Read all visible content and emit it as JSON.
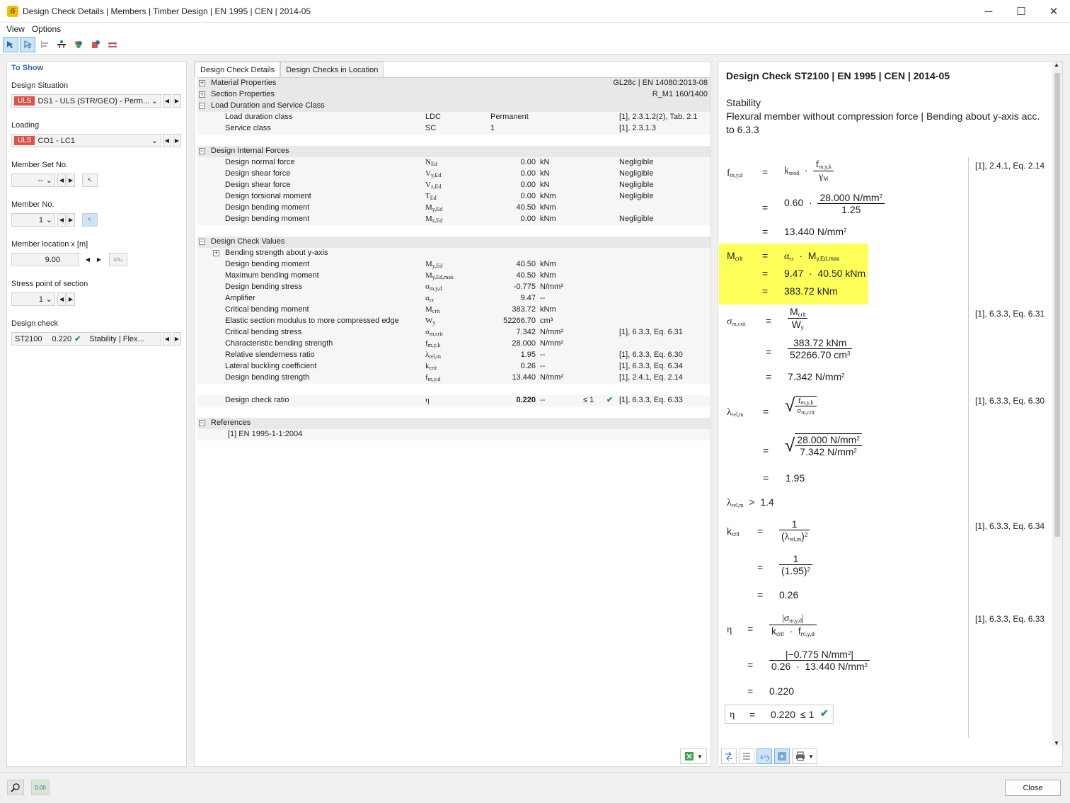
{
  "window": {
    "title": "Design Check Details | Members | Timber Design | EN 1995 | CEN | 2014-05",
    "min": "─",
    "max": "☐",
    "close": "✕"
  },
  "menu": {
    "view": "View",
    "options": "Options"
  },
  "left": {
    "head": "To Show",
    "situation_label": "Design Situation",
    "situation_tag": "ULS",
    "situation_value": "DS1 - ULS (STR/GEO) - Perm...",
    "loading_label": "Loading",
    "loading_tag": "ULS",
    "loading_value": "CO1 - LC1",
    "memberset_label": "Member Set No.",
    "memberset_value": "--",
    "member_label": "Member No.",
    "member_value": "1",
    "location_label": "Member location x [m]",
    "location_value": "9.00",
    "stress_label": "Stress point of section",
    "stress_value": "1",
    "check_label": "Design check",
    "check_id": "ST2100",
    "check_ratio": "0.220",
    "check_desc": "Stability | Flex..."
  },
  "tabs": {
    "t1": "Design Check Details",
    "t2": "Design Checks in Location"
  },
  "table": {
    "mat": {
      "label": "Material Properties",
      "right": "GL28c | EN 14080:2013-08"
    },
    "sec": {
      "label": "Section Properties",
      "right": "R_M1 160/1400"
    },
    "ld": {
      "label": "Load Duration and Service Class"
    },
    "ld_rows": [
      {
        "name": "Load duration class",
        "sym": "LDC",
        "val": "Permanent",
        "ref": "[1], 2.3.1.2(2), Tab. 2.1"
      },
      {
        "name": "Service class",
        "sym": "SC",
        "val": "1",
        "ref": "[1], 2.3.1.3"
      }
    ],
    "dif": {
      "label": "Design Internal Forces"
    },
    "dif_rows": [
      {
        "name": "Design normal force",
        "sym": "NEd",
        "val": "0.00",
        "unit": "kN",
        "ref": "Negligible"
      },
      {
        "name": "Design shear force",
        "sym": "Vy,Ed",
        "val": "0.00",
        "unit": "kN",
        "ref": "Negligible"
      },
      {
        "name": "Design shear force",
        "sym": "Vz,Ed",
        "val": "0.00",
        "unit": "kN",
        "ref": "Negligible"
      },
      {
        "name": "Design torsional moment",
        "sym": "TEd",
        "val": "0.00",
        "unit": "kNm",
        "ref": "Negligible"
      },
      {
        "name": "Design bending moment",
        "sym": "My,Ed",
        "val": "40.50",
        "unit": "kNm",
        "ref": ""
      },
      {
        "name": "Design bending moment",
        "sym": "Mz,Ed",
        "val": "0.00",
        "unit": "kNm",
        "ref": "Negligible"
      }
    ],
    "dcv": {
      "label": "Design Check Values"
    },
    "bend": {
      "label": "Bending strength about y-axis"
    },
    "dcv_rows": [
      {
        "name": "Design bending moment",
        "sym": "My,Ed",
        "val": "40.50",
        "unit": "kNm",
        "ref": ""
      },
      {
        "name": "Maximum bending moment",
        "sym": "My,Ed,max",
        "val": "40.50",
        "unit": "kNm",
        "ref": ""
      },
      {
        "name": "Design bending stress",
        "sym": "σm,y,d",
        "val": "-0.775",
        "unit": "N/mm²",
        "ref": ""
      },
      {
        "name": "Amplifier",
        "sym": "αcr",
        "val": "9.47",
        "unit": "--",
        "ref": ""
      },
      {
        "name": "Critical bending moment",
        "sym": "Mcrit",
        "val": "383.72",
        "unit": "kNm",
        "ref": ""
      },
      {
        "name": "Elastic section modulus to more compressed edge",
        "sym": "Wy",
        "val": "52266.70",
        "unit": "cm³",
        "ref": ""
      },
      {
        "name": "Critical bending stress",
        "sym": "σm,crit",
        "val": "7.342",
        "unit": "N/mm²",
        "ref": "[1], 6.3.3, Eq. 6.31"
      },
      {
        "name": "Characteristic bending strength",
        "sym": "fm,y,k",
        "val": "28.000",
        "unit": "N/mm²",
        "ref": ""
      },
      {
        "name": "Relative slenderness ratio",
        "sym": "λrel,m",
        "val": "1.95",
        "unit": "--",
        "ref": "[1], 6.3.3, Eq. 6.30"
      },
      {
        "name": "Lateral buckling coefficient",
        "sym": "kcrit",
        "val": "0.26",
        "unit": "--",
        "ref": "[1], 6.3.3, Eq. 6.34"
      },
      {
        "name": "Design bending strength",
        "sym": "fm,y,d",
        "val": "13.440",
        "unit": "N/mm²",
        "ref": "[1], 2.4.1, Eq. 2.14"
      }
    ],
    "ratio": {
      "name": "Design check ratio",
      "sym": "η",
      "val": "0.220",
      "unit": "--",
      "le": "≤ 1",
      "ok": "✔",
      "ref": "[1], 6.3.3, Eq. 6.33"
    },
    "refs": {
      "label": "References",
      "item": "[1]  EN 1995-1-1:2004"
    }
  },
  "right": {
    "title": "Design Check ST2100 | EN 1995 | CEN | 2014-05",
    "cat": "Stability",
    "desc1": "Flexural member without compression force | Bending about y-axis acc.",
    "desc2": "to 6.3.3",
    "ref1": "[1], 2.4.1, Eq. 2.14",
    "ref2": "[1], 6.3.3, Eq. 6.31",
    "ref3": "[1], 6.3.3, Eq. 6.30",
    "ref4": "[1], 6.3.3, Eq. 6.34",
    "ref5": "[1], 6.3.3, Eq. 6.33",
    "f1_kmod": "0.60",
    "f1_num": "28.000 N/mm",
    "f1_den": "1.25",
    "f1_res": "13.440 N/mm",
    "m1": "9.47",
    "m2": "40.50 kNm",
    "m_res": "383.72 kNm",
    "s_num": "383.72 kNm",
    "s_den": "52266.70 cm",
    "s_res": "7.342 N/mm",
    "l_num": "28.000 N/mm",
    "l_den": "7.342 N/mm",
    "l_res": "1.95",
    "l_cmp": "1.4",
    "k_num": "1",
    "k_den2": "(1.95)",
    "k_res": "0.26",
    "e_num": "|−0.775 N/mm",
    "e_den1": "0.26",
    "e_den2": "13.440 N/mm",
    "e_res": "0.220",
    "final_val": "0.220",
    "final_le": "≤ 1"
  },
  "footer": {
    "close": "Close"
  }
}
